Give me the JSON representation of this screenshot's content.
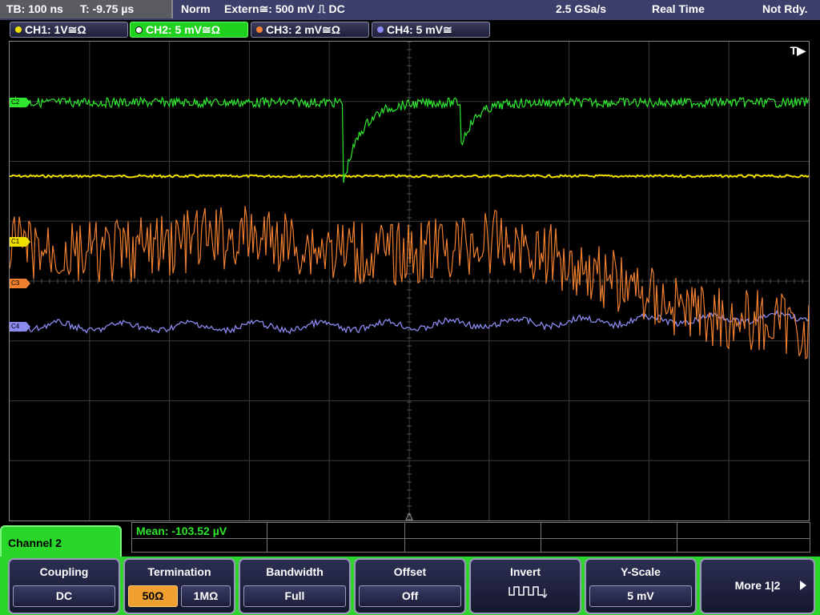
{
  "status_bar": {
    "timebase": "TB: 100 ns",
    "trigger_time": "T: -9.75 µs",
    "mode": "Norm",
    "trigger_source": "Extern≅: 500 mV ⎍ DC",
    "sample_rate": "2.5 GSa/s",
    "acquisition": "Real Time",
    "state": "Not Rdy."
  },
  "channels": [
    {
      "label": "CH1: 1V≅Ω",
      "color": "#f0e000",
      "active": false
    },
    {
      "label": "CH2: 5 mV≅Ω",
      "color": "#2ee62e",
      "active": true
    },
    {
      "label": "CH3: 2 mV≅Ω",
      "color": "#f08030",
      "active": false
    },
    {
      "label": "CH4: 5 mV≅",
      "color": "#8a8af0",
      "active": false
    }
  ],
  "screen": {
    "trigger_marker": "T▶",
    "markers": [
      {
        "label": "C2",
        "color": "#2ee62e"
      },
      {
        "label": "C1",
        "color": "#f0e000"
      },
      {
        "label": "C3",
        "color": "#f08030"
      },
      {
        "label": "C4",
        "color": "#8a8af0"
      }
    ]
  },
  "measurement": {
    "mean": "Mean: -103.52 µV"
  },
  "menu": {
    "title": "Channel 2",
    "softkeys": [
      {
        "title": "Coupling",
        "value": "DC"
      },
      {
        "title": "Termination",
        "options": [
          "50Ω",
          "1MΩ"
        ],
        "selected": "50Ω"
      },
      {
        "title": "Bandwidth",
        "value": "Full"
      },
      {
        "title": "Offset",
        "value": "Off"
      },
      {
        "title": "Invert",
        "icon": "invert-wave-icon"
      },
      {
        "title": "Y-Scale",
        "value": "5 mV"
      },
      {
        "title": "More 1|2",
        "icon": "right-arrow-icon"
      }
    ]
  },
  "colors": {
    "accent_green": "#2bd62b",
    "ch1": "#f0e000",
    "ch2": "#2ee62e",
    "ch3": "#f08030",
    "ch4": "#8a8af0"
  }
}
